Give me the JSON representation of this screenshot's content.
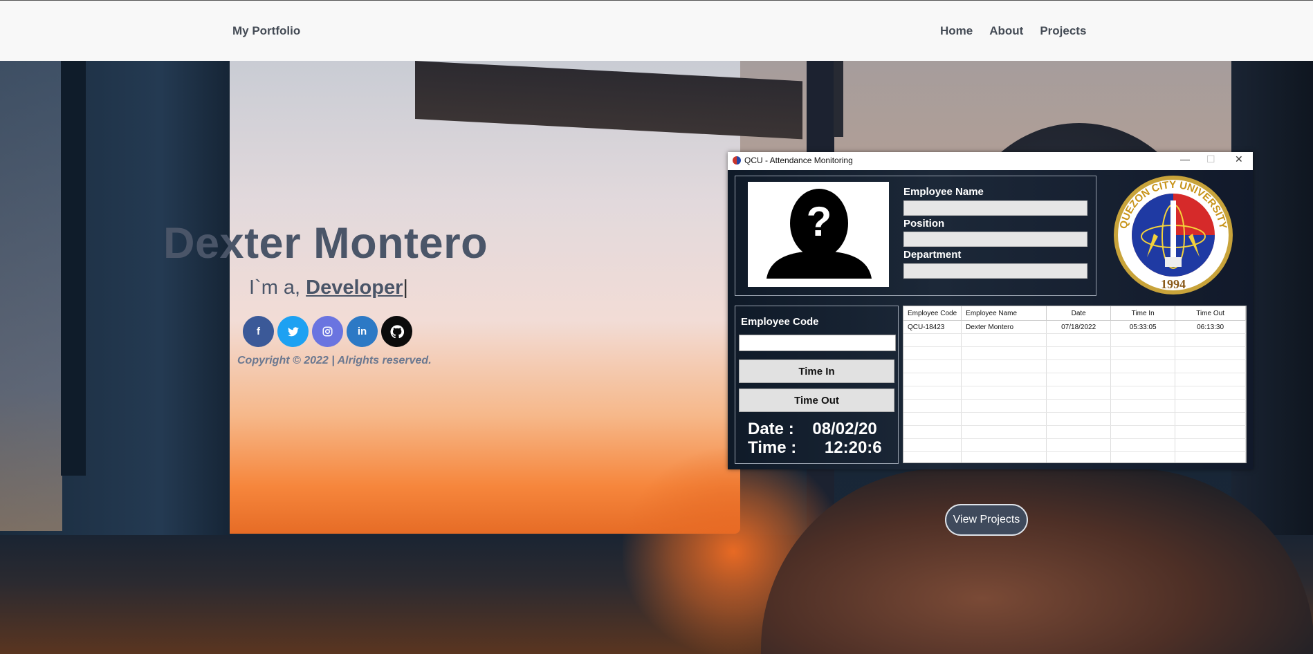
{
  "navbar": {
    "brand": "My Portfolio",
    "links": [
      "Home",
      "About",
      "Projects"
    ]
  },
  "hero": {
    "name": "Dexter Montero",
    "tagline_prefix": "I`m a, ",
    "role": "Developer",
    "cursor": "|",
    "social": [
      {
        "name": "facebook-icon",
        "glyph": "f",
        "color": "#3b5998"
      },
      {
        "name": "twitter-icon",
        "glyph": "t",
        "color": "#1da1f2"
      },
      {
        "name": "instagram-icon",
        "glyph": "◎",
        "color": "#6a74e0"
      },
      {
        "name": "linkedin-icon",
        "glyph": "in",
        "color": "#2c79c5"
      },
      {
        "name": "github-icon",
        "glyph": "●",
        "color": "#0b0b0b"
      }
    ],
    "copyright": "Copyright © 2022 | Alrights reserved.",
    "view_projects": "View Projects"
  },
  "app_window": {
    "title": "QCU - Attendance Monitoring",
    "controls": {
      "minimize": "—",
      "maximize": "☐",
      "close": "✕"
    },
    "labels": {
      "employee_name": "Employee Name",
      "position": "Position",
      "department": "Department",
      "employee_code": "Employee Code",
      "time_in": "Time In",
      "time_out": "Time Out"
    },
    "date_label": "Date :",
    "date_value": "08/02/20",
    "time_label": "Time :",
    "time_value": "12:20:6",
    "seal_text": "QUEZON CITY UNIVERSITY",
    "seal_year": "1994",
    "table": {
      "headers": [
        "Employee Code",
        "Employee Name",
        "Date",
        "Time In",
        "Time Out"
      ],
      "rows": [
        [
          "QCU-18423",
          "Dexter Montero",
          "07/18/2022",
          "05:33:05",
          "06:13:30"
        ]
      ]
    }
  },
  "colors": {
    "navbar_bg": "#f8f8f8",
    "heading": "#4a5568",
    "view_projects_bg": "#3f4a5c"
  }
}
